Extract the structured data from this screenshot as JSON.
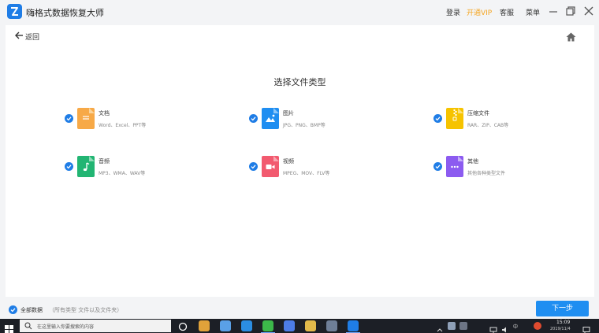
{
  "app": {
    "title": "嗨格式数据恢复大师",
    "menu": {
      "login": "登录",
      "vip": "开通VIP",
      "service": "客服",
      "menu": "菜单"
    }
  },
  "nav": {
    "back_label": "返回"
  },
  "heading": "选择文件类型",
  "file_types": [
    {
      "name": "文档",
      "desc": "Word、Excel、PPT等",
      "color": "#f7a947",
      "icon": "document-icon"
    },
    {
      "name": "图片",
      "desc": "JPG、PNG、BMP等",
      "color": "#1f8ef1",
      "icon": "image-icon"
    },
    {
      "name": "压缩文件",
      "desc": "RAR、ZIP、CAB等",
      "color": "#f6c300",
      "icon": "zip-icon"
    },
    {
      "name": "音频",
      "desc": "MP3、WMA、WAV等",
      "color": "#22b573",
      "icon": "audio-icon"
    },
    {
      "name": "视频",
      "desc": "MPEG、MOV、FLV等",
      "color": "#f25a6f",
      "icon": "video-icon"
    },
    {
      "name": "其他",
      "desc": "其他各种类型文件",
      "color": "#8c5bf0",
      "icon": "other-icon"
    }
  ],
  "footer": {
    "all_data_label": "全部数据",
    "all_data_note": "（所有类型 文件以及文件夹）",
    "next_label": "下一步"
  },
  "taskbar": {
    "search_placeholder": "在这里输入你要搜索的内容",
    "ime": "中",
    "time": "15:09",
    "date": "2019/11/4"
  }
}
